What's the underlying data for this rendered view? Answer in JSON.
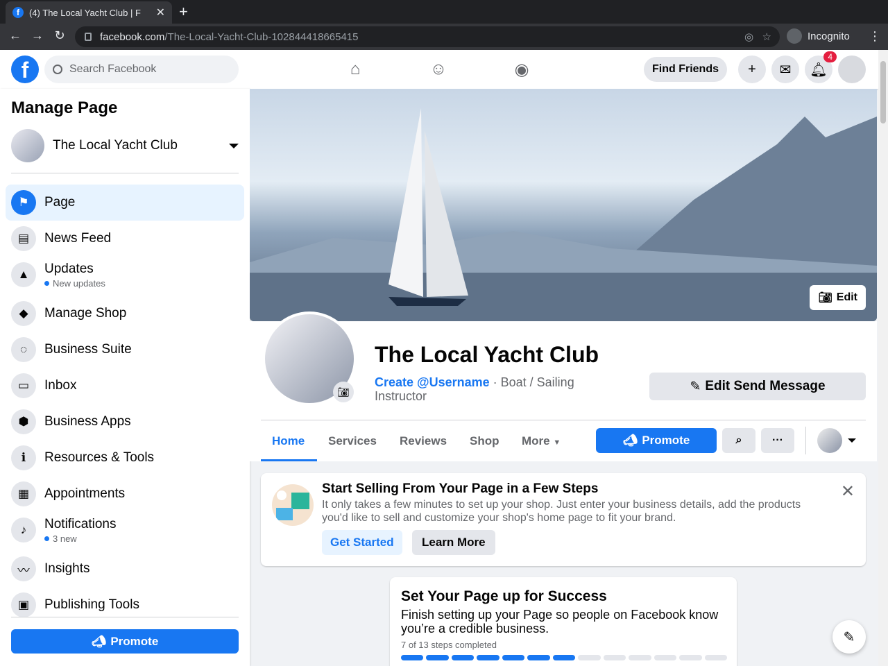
{
  "browser": {
    "tab_title": "(4) The Local Yacht Club | F",
    "url_host": "facebook.com",
    "url_path": "/The-Local-Yacht-Club-102844418665415",
    "incognito_label": "Incognito"
  },
  "fb": {
    "search_placeholder": "Search Facebook",
    "find_friends": "Find Friends",
    "notif_count": "4"
  },
  "sidebar": {
    "title": "Manage Page",
    "page_name": "The Local Yacht Club",
    "items": [
      {
        "label": "Page",
        "icon": "flag-icon"
      },
      {
        "label": "News Feed",
        "icon": "newsfeed-icon"
      },
      {
        "label": "Updates",
        "sub": "New updates",
        "icon": "updates-icon"
      },
      {
        "label": "Manage Shop",
        "icon": "shop-bag-icon"
      },
      {
        "label": "Business Suite",
        "icon": "business-suite-icon"
      },
      {
        "label": "Inbox",
        "icon": "inbox-icon"
      },
      {
        "label": "Business Apps",
        "icon": "cube-icon"
      },
      {
        "label": "Resources & Tools",
        "icon": "info-icon"
      },
      {
        "label": "Appointments",
        "icon": "calendar-icon"
      },
      {
        "label": "Notifications",
        "sub": "3 new",
        "icon": "bell-icon"
      },
      {
        "label": "Insights",
        "icon": "insights-icon"
      },
      {
        "label": "Publishing Tools",
        "icon": "publishing-icon"
      }
    ],
    "promote": "Promote"
  },
  "profile": {
    "cover_edit": "Edit",
    "name": "The Local Yacht Club",
    "create_username": "Create @Username",
    "category": " · Boat / Sailing Instructor",
    "edit_send": "Edit Send Message",
    "tabs": [
      "Home",
      "Services",
      "Reviews",
      "Shop",
      "More"
    ],
    "promote": "Promote"
  },
  "shop_card": {
    "title": "Start Selling From Your Page in a Few Steps",
    "desc": "It only takes a few minutes to set up your shop. Just enter your business details, add the products you'd like to sell and customize your shop's home page to fit your brand.",
    "get_started": "Get Started",
    "learn_more": "Learn More"
  },
  "success_card": {
    "title": "Set Your Page up for Success",
    "desc": "Finish setting up your Page so people on Facebook know you’re a credible business.",
    "steps": "7 of 13 steps completed",
    "completed": 7,
    "total": 13
  }
}
